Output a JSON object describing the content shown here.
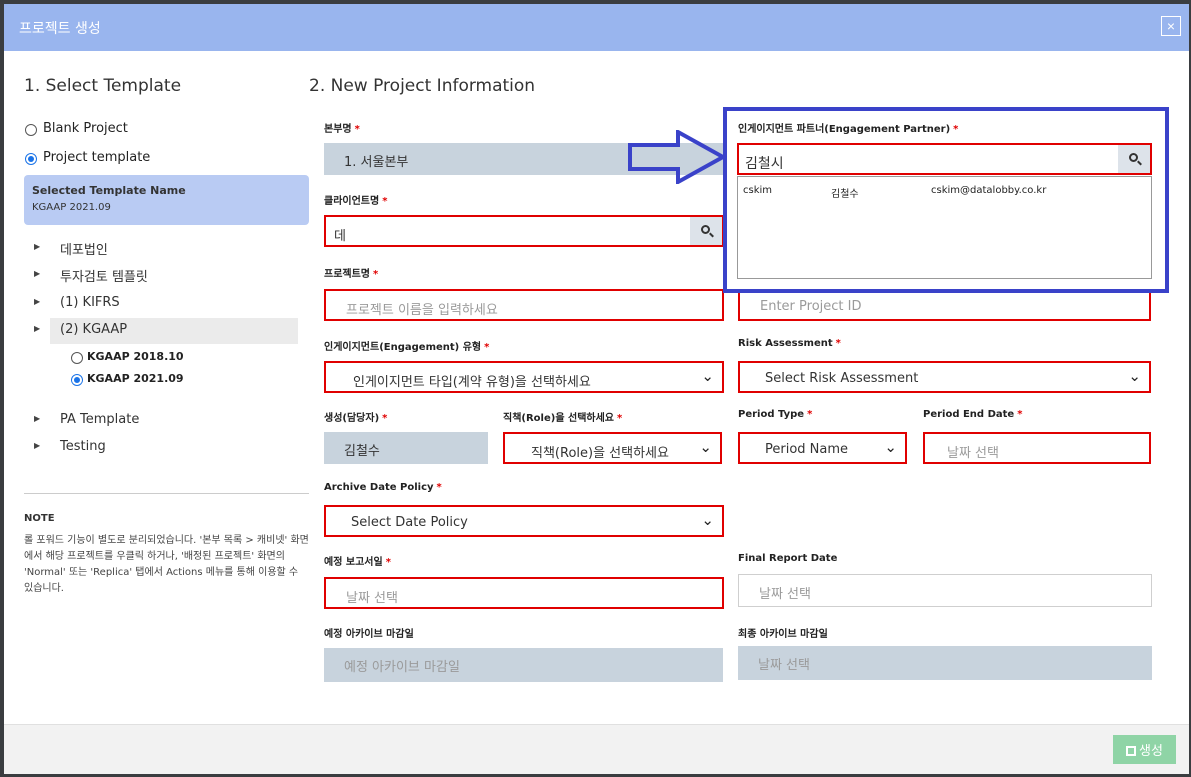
{
  "modal": {
    "title": "프로젝트 생성",
    "close": "×"
  },
  "left": {
    "title": "1. Select Template",
    "options": [
      {
        "label": "Blank Project",
        "checked": false
      },
      {
        "label": "Project template",
        "checked": true
      }
    ],
    "selected_template": {
      "heading": "Selected Template Name",
      "value": "KGAAP 2021.09"
    },
    "tree": [
      "데포법인",
      "투자검토 템플릿",
      "(1) KIFRS",
      "(2) KGAAP",
      "PA Template",
      "Testing"
    ],
    "sub_options": [
      {
        "label": "KGAAP 2018.10",
        "checked": false
      },
      {
        "label": "KGAAP 2021.09",
        "checked": true
      }
    ],
    "note_title": "NOTE",
    "note_text": "롤 포워드 기능이 별도로 분리되었습니다. '본부 목록 > 캐비넷' 화면에서 해당 프로젝트를 우클릭 하거나, '배정된 프로젝트' 화면의 'Normal' 또는 'Replica' 탭에서 Actions 메뉴를 통해 이용할 수 있습니다."
  },
  "right": {
    "title": "2. New Project Information",
    "required_mark": "*",
    "division": {
      "label": "본부명",
      "value": "1. 서울본부"
    },
    "partner": {
      "label": "인게이지먼트 파트너(Engagement Partner)",
      "value": "김철시"
    },
    "partner_results": [
      {
        "id": "cskim",
        "name": "김철수",
        "email": "cskim@datalobby.co.kr"
      }
    ],
    "client": {
      "label": "클라이언트명",
      "value": "데"
    },
    "project_name": {
      "label": "프로젝트명",
      "placeholder": "프로젝트 이름을 입력하세요"
    },
    "project_id": {
      "placeholder": "Enter Project ID"
    },
    "engagement_type": {
      "label": "인게이지먼트(Engagement) 유형",
      "value": "인게이지먼트 타입(계약 유형)을 선택하세요"
    },
    "risk": {
      "label": "Risk Assessment",
      "value": "Select Risk Assessment"
    },
    "creator": {
      "label": "생성(담당자)",
      "value": "김철수"
    },
    "role": {
      "label": "직책(Role)을 선택하세요",
      "value": "직책(Role)을 선택하세요"
    },
    "period_type": {
      "label": "Period Type",
      "value": "Period Name"
    },
    "period_end": {
      "label": "Period End Date",
      "placeholder": "날짜 선택"
    },
    "archive_policy": {
      "label": "Archive Date Policy",
      "value": "Select Date Policy"
    },
    "report_date": {
      "label": "예정 보고서일",
      "placeholder": "날짜 선택"
    },
    "final_report": {
      "label": "Final Report Date",
      "placeholder": "날짜 선택"
    },
    "archive_deadline": {
      "label": "예정 아카이브 마감일",
      "placeholder": "예정 아카이브 마감일"
    },
    "final_archive": {
      "label": "최종 아카이브 마감일",
      "placeholder": "날짜 선택"
    }
  },
  "footer": {
    "create_label": "생성"
  }
}
